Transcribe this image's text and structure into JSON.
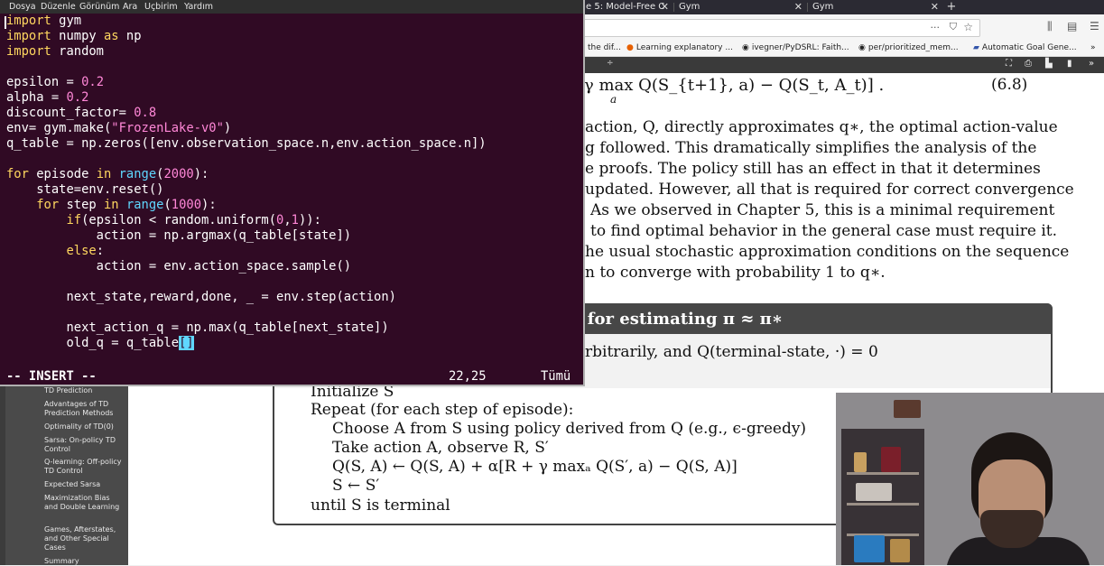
{
  "terminal": {
    "menu": [
      "Dosya",
      "Düzenle",
      "Görünüm",
      "Ara",
      "Uçbirim",
      "Yardım"
    ],
    "code_lines": [
      [
        [
          "kw",
          "import"
        ],
        [
          "t",
          " gym"
        ]
      ],
      [
        [
          "kw",
          "import"
        ],
        [
          "t",
          " numpy "
        ],
        [
          "kw",
          "as"
        ],
        [
          "t",
          " np"
        ]
      ],
      [
        [
          "kw",
          "import"
        ],
        [
          "t",
          " random"
        ]
      ],
      [],
      [
        [
          "t",
          "epsilon = "
        ],
        [
          "num",
          "0.2"
        ]
      ],
      [
        [
          "t",
          "alpha = "
        ],
        [
          "num",
          "0.2"
        ]
      ],
      [
        [
          "t",
          "discount_factor= "
        ],
        [
          "num",
          "0.8"
        ]
      ],
      [
        [
          "t",
          "env= gym.make("
        ],
        [
          "str",
          "\"FrozenLake-v0\""
        ],
        [
          "t",
          ")"
        ]
      ],
      [
        [
          "t",
          "q_table = np.zeros([env.observation_space.n,env.action_space.n])"
        ]
      ],
      [],
      [
        [
          "kw",
          "for"
        ],
        [
          "t",
          " episode "
        ],
        [
          "kw",
          "in"
        ],
        [
          "t",
          " "
        ],
        [
          "bi",
          "range"
        ],
        [
          "t",
          "("
        ],
        [
          "num",
          "2000"
        ],
        [
          "t",
          "):"
        ]
      ],
      [
        [
          "t",
          "    state=env.reset()"
        ]
      ],
      [
        [
          "t",
          "    "
        ],
        [
          "kw",
          "for"
        ],
        [
          "t",
          " step "
        ],
        [
          "kw",
          "in"
        ],
        [
          "t",
          " "
        ],
        [
          "bi",
          "range"
        ],
        [
          "t",
          "("
        ],
        [
          "num",
          "1000"
        ],
        [
          "t",
          "):"
        ]
      ],
      [
        [
          "t",
          "        "
        ],
        [
          "kw",
          "if"
        ],
        [
          "t",
          "(epsilon < random.uniform("
        ],
        [
          "num",
          "0"
        ],
        [
          "t",
          ","
        ],
        [
          "num",
          "1"
        ],
        [
          "t",
          "))"
        ],
        [
          "t",
          ":"
        ]
      ],
      [
        [
          "t",
          "            action = np.argmax(q_table[state])"
        ]
      ],
      [
        [
          "t",
          "        "
        ],
        [
          "kw",
          "else"
        ],
        [
          "t",
          ":"
        ]
      ],
      [
        [
          "t",
          "            action = env.action_space.sample()"
        ]
      ],
      [],
      [
        [
          "t",
          "        next_state,reward,done, _ = env.step(action)"
        ]
      ],
      [],
      [
        [
          "t",
          "        next_action_q = np.max(q_table[next_state])"
        ]
      ],
      [
        [
          "t",
          "        old_q = q_table"
        ],
        [
          "cur",
          "[]"
        ]
      ]
    ],
    "status": {
      "mode": "-- INSERT --",
      "position": "22,25",
      "scroll": "Tümü"
    }
  },
  "browser": {
    "tabs": [
      {
        "label": "e 5: Model-Free C"
      },
      {
        "label": "Gym"
      },
      {
        "label": "Gym"
      }
    ],
    "new_tab": "+",
    "bookmarks": [
      {
        "icon": "",
        "label": "the dif..."
      },
      {
        "icon": "●",
        "label": "Learning explanatory ..."
      },
      {
        "icon": "◉",
        "label": "ivegner/PyDSRL: Faith..."
      },
      {
        "icon": "◉",
        "label": "per/prioritized_mem..."
      },
      {
        "icon": "▰",
        "label": "Automatic Goal Gene..."
      }
    ],
    "more_bookmarks": "»",
    "zoom": "÷"
  },
  "sidebar": {
    "items": [
      "TD Prediction",
      "Advantages of TD Prediction Methods",
      "Optimality of TD(0)",
      "Sarsa: On-policy TD Control",
      "Q-learning: Off-policy TD Control",
      "Expected Sarsa",
      "Maximization Bias and Double Learning",
      "Games, Afterstates, and Other Special Cases",
      "Summary"
    ]
  },
  "pdf": {
    "equation": "γ max Q(S_{t+1}, a) − Q(S_t, A_t)] .",
    "equation_sub": "a",
    "equation_number": "(6.8)",
    "paragraph": [
      "action, Q, directly approximates q∗, the optimal action-value",
      "g followed.  This dramatically simplifies the analysis of the",
      "e proofs.  The policy still has an effect in that it determines",
      "updated. However, all that is required for correct convergence",
      "As we observed in Chapter 5, this is a minimal requirement",
      "to find optimal behavior in the general case must require it.",
      "he usual stochastic approximation conditions on the sequence",
      "n to converge with probability 1 to q∗."
    ],
    "algo_title": ") for estimating π ≈ π∗",
    "algo_init": "rbitrarily, and Q(terminal-state, ·) = 0",
    "algo_lines": [
      "Initialize S",
      "Repeat (for each step of episode):",
      "Choose A from S using policy derived from Q (e.g., ϵ-greedy)",
      "Take action A, observe R, S′",
      "Q(S, A) ← Q(S, A) + α[R + γ maxₐ Q(S′, a) − Q(S, A)]",
      "S ← S′",
      "until S is terminal"
    ]
  }
}
